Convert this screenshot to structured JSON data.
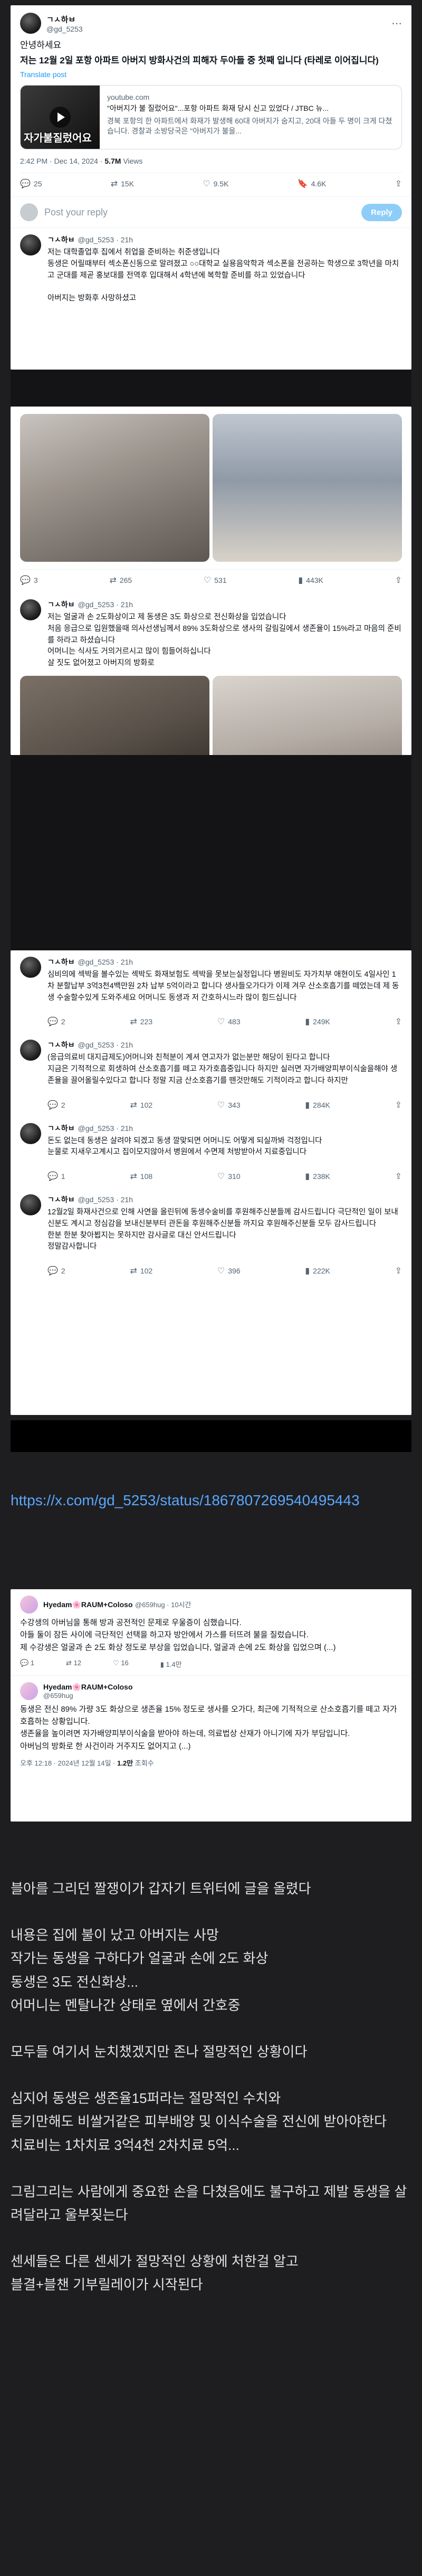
{
  "tweet1": {
    "name": "ㄱㅅ하ㅂ",
    "handle": "@gd_5253",
    "greeting": "안녕하세요",
    "body": "저는 12월 2일 포항 아파트 아버지 방화사건의 피해자 두아들 중 첫째 입니다 (타레로 이어집니다)",
    "translate": "Translate post",
    "link_domain": "youtube.com",
    "link_title": "\"아버지가 불 질렀어요\"...포항 아파트 화재 당시 신고 있었다 / JTBC 뉴...",
    "link_desc": "경북 포항의 한 아파트에서 화재가 발생해 60대 아버지가 숨지고, 20대 아들 두 명이 크게 다쳤습니다. 경찰과 소방당국은 \"아버지가 불을...",
    "thumb_caption": "자가불질렀어요",
    "time": "2:42 PM · Dec 14, 2024 · ",
    "views": "5.7M",
    "views_label": " Views",
    "stats": {
      "replies": "25",
      "reposts": "15K",
      "likes": "9.5K",
      "bookmarks": "4.6K"
    },
    "reply_placeholder": "Post your reply",
    "reply_button": "Reply"
  },
  "comment1": {
    "name": "ㄱㅅ하ㅂ",
    "handle": "@gd_5253 · 21h",
    "text": "저는 대학졸업후 집에서 취업을 준비하는 취준생입니다\n동생은 어릴때부터 섹소폰신동으로 알려졌고 ○○대학교 실용음악학과 섹소폰을 전공하는 학생으로 3학년을 마치고 군대를 제곧 홍보대를 전역후 입대해서 4학년에 복학할 준비를 하고 있었습니다\n\n아버지는 방화후 사망하셨고"
  },
  "comment2": {
    "stats": {
      "replies": "3",
      "reposts": "265",
      "likes": "531",
      "views": "443K"
    },
    "name": "ㄱㅅ하ㅂ",
    "handle": "@gd_5253 · 21h",
    "text": "저는 얼굴과 손 2도화상이고 제 동생은 3도 화상으로 전신화상을 입었습니다\n처음 응급으로 입원했을때 의사선생님께서 89% 3도화상으로 생사의 갈림길에서 생존율이 15%라고 마음의 준비를 하라고 하셨습니다\n어머니는 식사도 거의거르시고 많이 힘들어하십니다\n살 짓도 없어졌고 아버지의 방화로"
  },
  "comment3": {
    "name": "ㄱㅅ하ㅂ",
    "handle": "@gd_5253 · 21h",
    "text": "심비의에 섹박을 볼수있는 섹박도 화재보험도 섹박을 못보는실정입니다 병원비도 자가치부 애현이도 4일사인 1차 분할납부 3억3천4백만원 2차 납부 5억이라고 합니다 생사들오가다가 이제 겨우 산소호흡기를 떼었는데 제 동생 수술할수있게 도와주세요 어머니도 동생과 저 간호하시느라 많이 힘드십니다",
    "stats": {
      "replies": "2",
      "reposts": "223",
      "likes": "483",
      "views": "249K"
    }
  },
  "comment4": {
    "name": "ㄱㅅ하ㅂ",
    "handle": "@gd_5253 · 21h",
    "text": "(응급의료비 대지급제도)어머니와 친척분이 계셔 연고자가 없는분만 해당이 된다고 합니다\n지금은 기적적으로 회생하여 산소호흡기를 떼고 자가호흡중입니다 하지만 실러면 자가배양피부이식술을해야 생존율을 끌어올릴수있다고 합니다 정말 지금 산소호흡기를 뗀것만해도 기적이라고 합니다 하지만",
    "stats": {
      "replies": "2",
      "reposts": "102",
      "likes": "343",
      "views": "284K"
    }
  },
  "comment5": {
    "name": "ㄱㅅ하ㅂ",
    "handle": "@gd_5253 · 21h",
    "text": "돈도 없는데 동생은 살려야 되겠고 동생 깔맞되면 어머니도 어떻게 되실까봐 걱정입니다\n눈물로 지새우고계시고 집이모지않아서 병원에서 수면제 처방받아서 지료중입니다",
    "stats": {
      "replies": "1",
      "reposts": "108",
      "likes": "310",
      "views": "238K"
    }
  },
  "comment6": {
    "name": "ㄱㅅ하ㅂ",
    "handle": "@gd_5253 · 21h",
    "text": "12월2일 화재사건으로 인해 사연을 올린뒤에 동생수술비를 후원해주신분들께 감사드립니다 극단적인 일이 보내신분도 계시고 정심감을 보내신분부터 관돈을 후원해주신분들 까지요 후원해주신분들 모두 감사드립니다\n한분 한분 찾아뵙지는 못하지만 감사글로 대신 안서드립니다\n정말감사합니다",
    "stats": {
      "replies": "2",
      "reposts": "102",
      "likes": "396",
      "views": "222K"
    }
  },
  "source_url": "https://x.com/gd_5253/status/1867807269540495443",
  "hyedam1": {
    "name": "Hyedam🌸RAUM+Coloso",
    "handle": "@659hug · 10시간",
    "text": "수강생의 아버님을 통해 방과 공전적인 문제로 우울증이 심했습니다.\n아들 둘이 잠든 사이에 극단적인 선택을 하고자 방안에서 가스를 터뜨려 불을 질렀습니다.\n제 수강생은 얼굴과 손 2도 화상 정도로 부상을 입었습니다, 얼굴과 손에 2도 화상을 입었으며 (...)",
    "stats": {
      "replies": "1",
      "reposts": "12",
      "likes": "16",
      "views": "1.4만"
    }
  },
  "hyedam2": {
    "name": "Hyedam🌸RAUM+Coloso",
    "handle": "@659hug",
    "text": "동생은 전신 89% 가량 3도 화상으로 생존율 15% 정도로 생사를 오가다, 최근에 기적적으로 산소호흡기를 떼고 자가 호흡하는 상황입니다.\n생존율을 높이려면 자가배양피부이식술을 받아야 하는데, 의료법상 산재가 아니기에 자가 부담입니다.\n아버님의 방화로 한 사건이라 거주지도 없어지고 (...)",
    "time": "오후 12:18 · 2024년 12월 14일 · ",
    "views": "1.2만",
    "views_label": " 조회수"
  },
  "article": [
    "블아를 그리던 짤쟁이가 갑자기 트위터에 글을 올렸다",
    "",
    "내용은 집에 불이 났고 아버지는 사망",
    "작가는 동생을 구하다가 얼굴과 손에 2도 화상",
    "동생은 3도 전신화상...",
    "어머니는 멘탈나간 상태로 옆에서 간호중",
    "",
    "모두들 여기서 눈치챘겠지만 존나 절망적인 상황이다",
    "",
    "심지어 동생은 생존율15퍼라는 절망적인 수치와",
    "듣기만해도 비쌀거같은 피부배양 및 이식수술을 전신에 받아야한다",
    "치료비는 1차치료 3억4천 2차치료 5억...",
    "",
    "그림그리는 사람에게 중요한 손을 다쳤음에도 불구하고 제발 동생을 살려달라고 울부짖는다",
    "",
    "센세들은 다른 센세가 절망적인 상황에 처한걸 알고",
    "블결+블챈 기부릴레이가 시작된다"
  ]
}
